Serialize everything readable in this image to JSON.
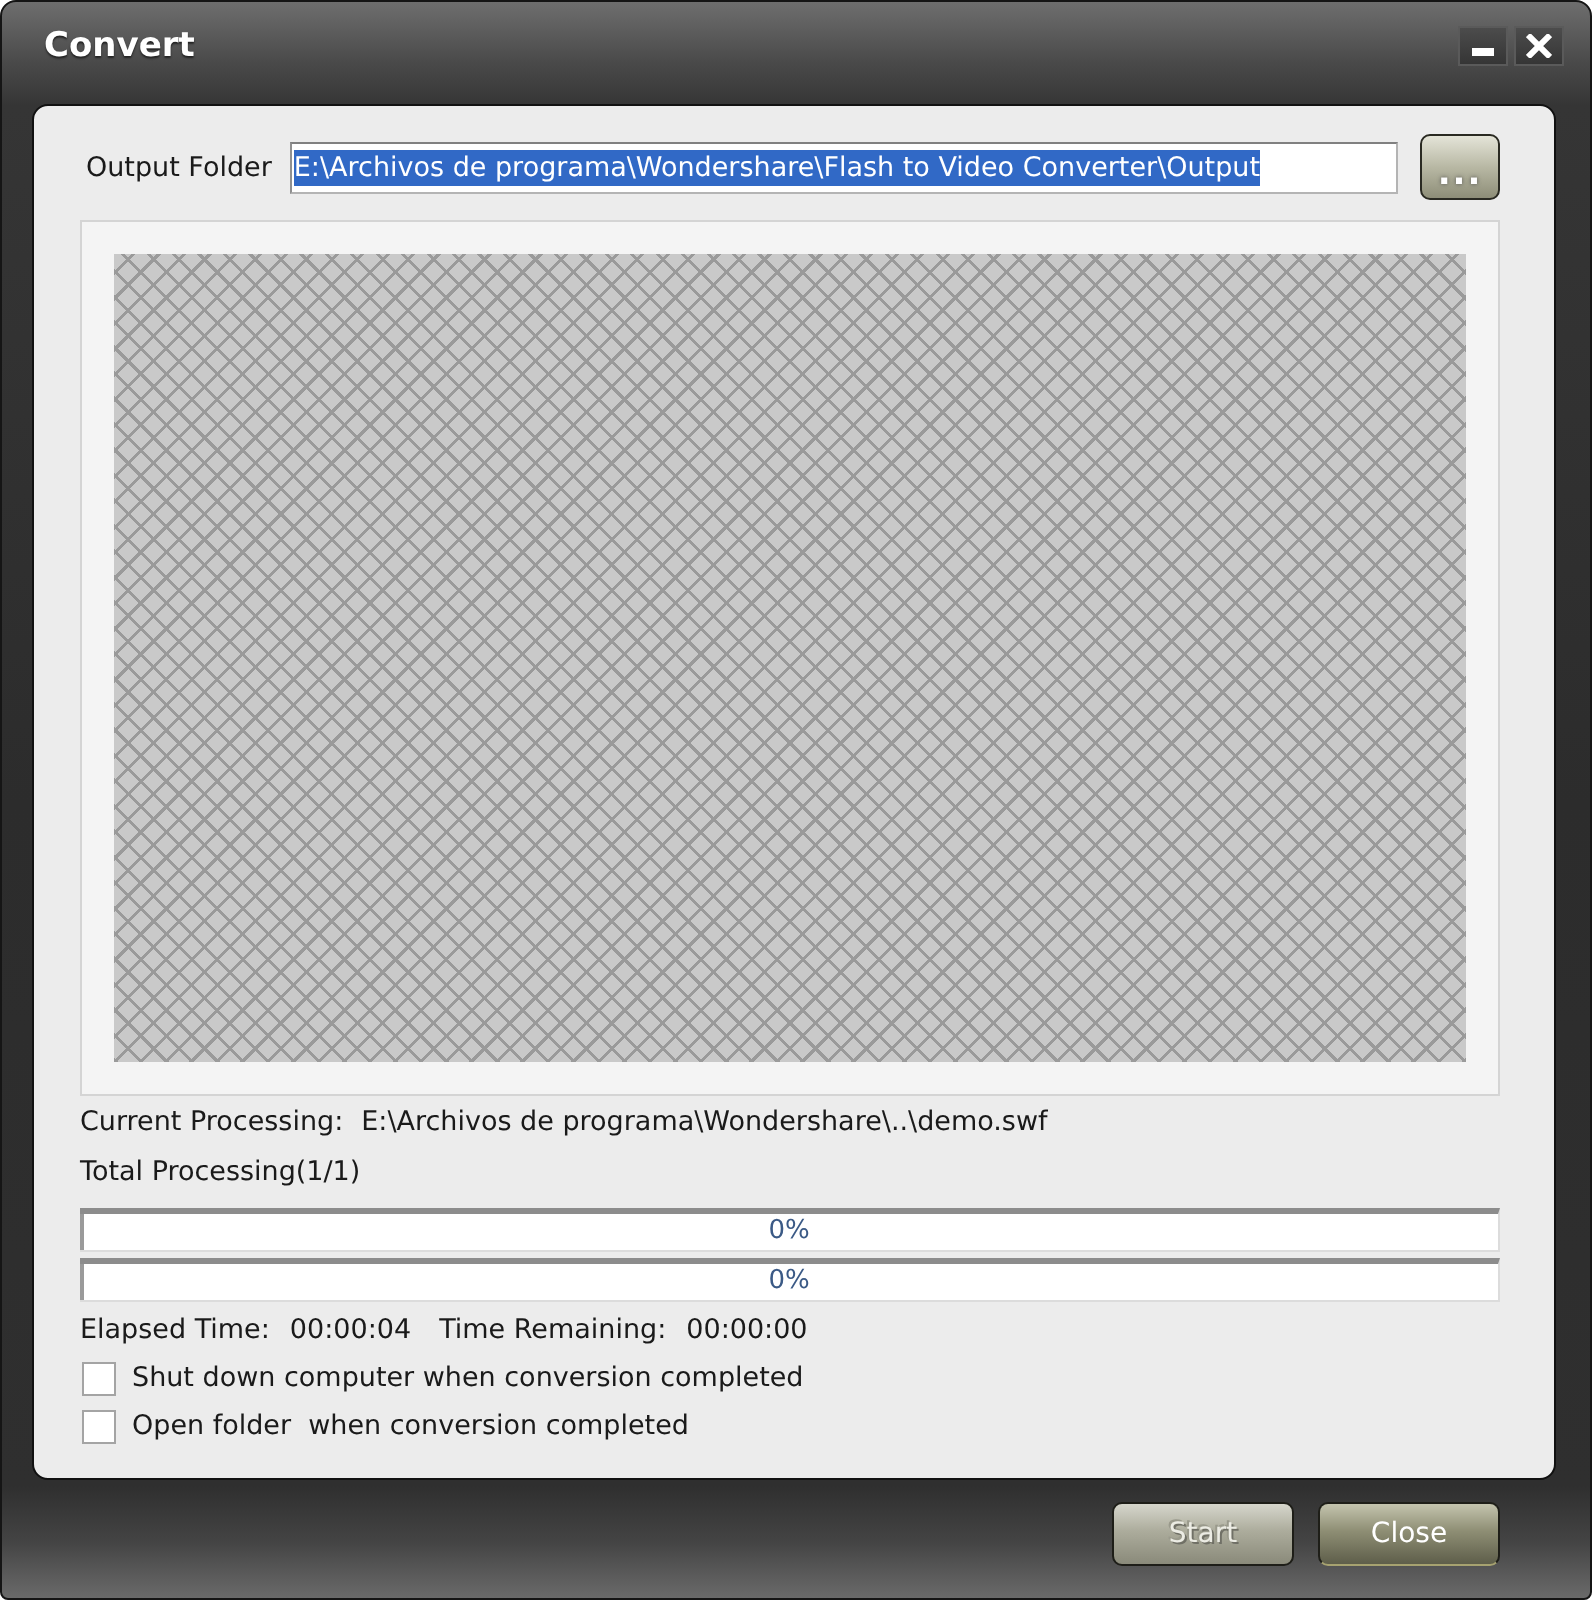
{
  "window": {
    "title": "Convert"
  },
  "output_folder": {
    "label": "Output Folder",
    "value": "E:\\Archivos de programa\\Wondershare\\Flash to Video Converter\\Output",
    "text_selected": true,
    "browse_button": "..."
  },
  "status": {
    "current_label": "Current Processing:",
    "current_value": "E:\\Archivos de programa\\Wondershare\\..\\demo.swf",
    "total": "Total Processing(1/1)"
  },
  "progress_bars": [
    {
      "level": 0,
      "reading": "0%"
    },
    {
      "level": 0,
      "reading": "0%"
    }
  ],
  "times": [
    {
      "label": "Elapsed Time:",
      "value": "00:00:04"
    },
    {
      "label": "Time Remaining:",
      "value": "00:00:00"
    }
  ],
  "options": [
    {
      "label": "Shut down computer when conversion completed",
      "checked": false
    },
    {
      "label": "Open folder  when conversion completed",
      "checked": false
    }
  ],
  "buttons": [
    {
      "label": "Start",
      "disabled": true
    },
    {
      "label": "Close",
      "disabled": false
    }
  ]
}
